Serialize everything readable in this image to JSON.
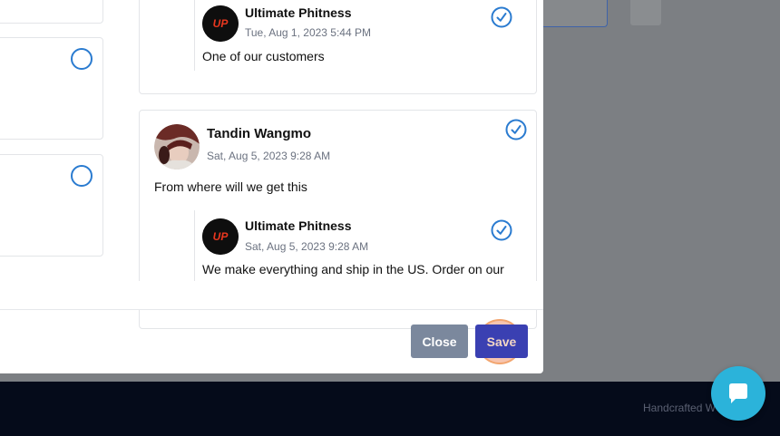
{
  "comments": [
    {
      "type": "reply",
      "author": "Ultimate Phitness",
      "time": "Tue, Aug 1, 2023 5:44 PM",
      "text": "One of our customers",
      "checked": true
    },
    {
      "type": "comment",
      "author": "Tandin Wangmo",
      "time": "Sat, Aug 5, 2023 9:28 AM",
      "text": "From where will we get this",
      "checked": true
    },
    {
      "type": "reply",
      "author": "Ultimate Phitness",
      "time": "Sat, Aug 5, 2023 9:28 AM",
      "text": "We make everything and ship in the US. Order on our",
      "checked": true
    }
  ],
  "buttons": {
    "close": "Close",
    "save": "Save"
  },
  "footer": {
    "text": "Handcrafted W"
  },
  "icons": {
    "check": "check-circle-icon",
    "radio": "radio-circle-icon",
    "chat": "chat-icon",
    "logo": "up-logo"
  },
  "colors": {
    "accent": "#2a7bd0",
    "save": "#3a40b2",
    "close": "#7b889d",
    "chat": "#2bb3da"
  }
}
